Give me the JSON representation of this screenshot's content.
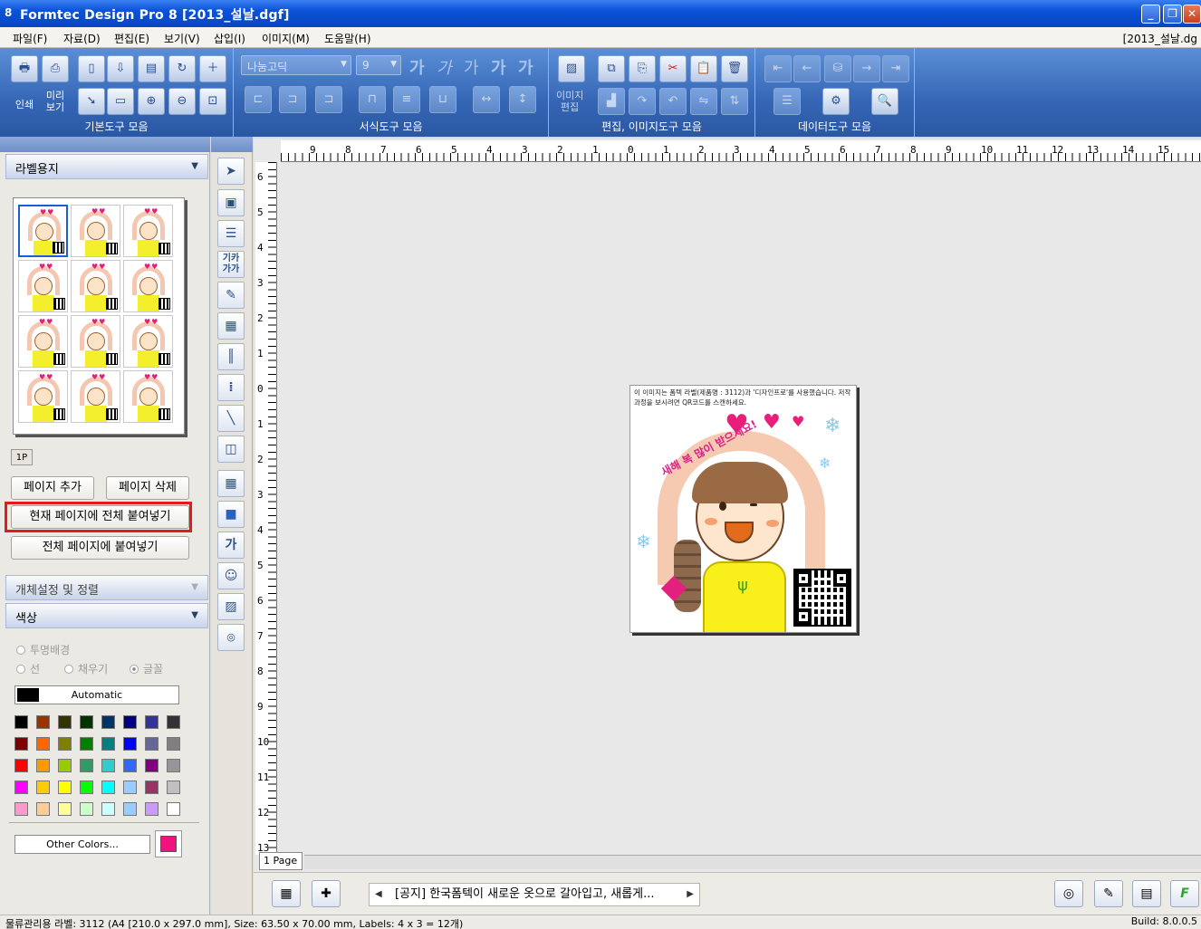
{
  "window": {
    "title": "Formtec Design Pro 8 [2013_설날.dgf]",
    "doc_tab": "[2013_설날.dg"
  },
  "menu": [
    "파일(F)",
    "자료(D)",
    "편집(E)",
    "보기(V)",
    "삽입(I)",
    "이미지(M)",
    "도움말(H)"
  ],
  "ribbon": {
    "groups": {
      "basic": "기본도구 모음",
      "format": "서식도구 모음",
      "edit": "편집, 이미지도구 모음",
      "data": "데이터도구 모음"
    },
    "print_label": "인쇄",
    "preview_label": "미리\n보기",
    "image_edit_label": "이미지\n편집",
    "font": "나눔고딕",
    "size": "9",
    "fmt_glyph": "가"
  },
  "left": {
    "label_paper": "라벨용지",
    "page_tab": "1P",
    "add_page": "페이지 추가",
    "delete_page": "페이지 삭제",
    "paste_current": "현재 페이지에 전체 붙여넣기",
    "paste_all": "전체 페이지에 붙여넣기",
    "object_settings": "개체설정 및 정렬",
    "color": "색상",
    "transparent": "투명배경",
    "line": "선",
    "fill": "채우기",
    "font": "글꼴",
    "automatic": "Automatic",
    "other_colors": "Other Colors...",
    "current_color": "#f1127f",
    "palette": [
      [
        "#000000",
        "#993300",
        "#333300",
        "#003300",
        "#003366",
        "#000080",
        "#333399",
        "#333333"
      ],
      [
        "#800000",
        "#ff6600",
        "#808000",
        "#008000",
        "#008080",
        "#0000ff",
        "#666699",
        "#808080"
      ],
      [
        "#ff0000",
        "#ff9900",
        "#99cc00",
        "#339966",
        "#33cccc",
        "#3366ff",
        "#800080",
        "#969696"
      ],
      [
        "#ff00ff",
        "#ffcc00",
        "#ffff00",
        "#00ff00",
        "#00ffff",
        "#99ccff",
        "#993366",
        "#c0c0c0"
      ],
      [
        "#ff99cc",
        "#ffcc99",
        "#ffff99",
        "#ccffcc",
        "#ccffff",
        "#99ccff",
        "#cc99ff",
        "#ffffff"
      ]
    ]
  },
  "ruler": {
    "h": [
      "9",
      "8",
      "7",
      "6",
      "5",
      "4",
      "3",
      "2",
      "1",
      "0",
      "1",
      "2",
      "3",
      "4",
      "5",
      "6",
      "7",
      "8",
      "9",
      "10",
      "11",
      "12",
      "13",
      "14",
      "15"
    ],
    "v": [
      "6",
      "5",
      "4",
      "3",
      "2",
      "1",
      "0",
      "1",
      "2",
      "3",
      "4",
      "5",
      "6",
      "7",
      "8",
      "9",
      "10",
      "11",
      "12",
      "13"
    ]
  },
  "canvas": {
    "page_tab": "1 Page",
    "notice": "이 이미지는 폼텍 라벨(제품명 : 3112)과 '디자인프로'를 사용했습니다. 저작과정을 보시려면 QR코드를 스캔하세요.",
    "greeting": "새해 복 많이 받으세요!"
  },
  "bottom": {
    "news": "[공지] 한국폼텍이 새로운 옷으로 갈아입고, 새롭게..."
  },
  "status": {
    "left": "물류관리용 라벨: 3112 (A4 [210.0 x 297.0 mm], Size: 63.50 x 70.00 mm,  Labels: 4 x 3 = 12개)",
    "build": "Build: 8.0.0.5"
  }
}
